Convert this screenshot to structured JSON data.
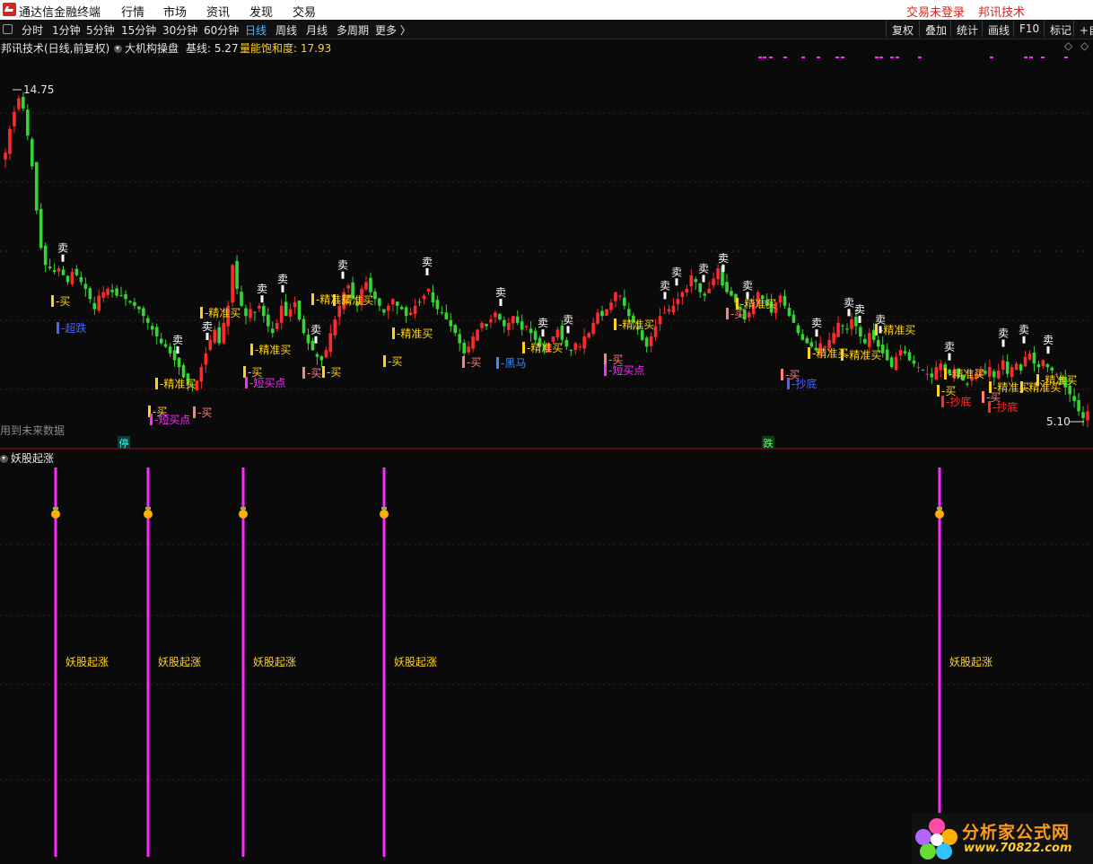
{
  "menubar": {
    "app_title": "通达信金融终端",
    "items": [
      "行情",
      "市场",
      "资讯",
      "发现",
      "交易"
    ],
    "right_items": [
      "交易未登录",
      "邦讯技术"
    ]
  },
  "toolbar": {
    "periods": [
      "分时",
      "1分钟",
      "5分钟",
      "15分钟",
      "30分钟",
      "60分钟",
      "日线",
      "周线",
      "月线",
      "多周期",
      "更多 〉"
    ],
    "active_period": "日线",
    "right_buttons": [
      "复权",
      "叠加",
      "统计",
      "画线",
      "F10",
      "标记",
      "+自"
    ]
  },
  "chart_header": {
    "title": "邦讯技术(日线,前复权)",
    "indicator_name": "大机构操盘",
    "baseline": "基线: 5.27",
    "saturation": "量能饱和度: 17.93"
  },
  "main_chart": {
    "high_label": "14.75",
    "low_label": "5.10",
    "future_note": "用到未来数据",
    "limit_up_badge": "停",
    "limit_down_badge": "跌",
    "sell_label": "卖",
    "signal_texts": {
      "buy": "买",
      "precise_buy": "精准买",
      "oversold": "超跌",
      "short_buy": "短买点",
      "dark_horse": "黑马",
      "bottom": "抄底"
    }
  },
  "chart_data": {
    "type": "candlestick",
    "price_range": [
      5.1,
      14.75
    ],
    "close_series": [
      12.9,
      13.6,
      14.1,
      14.5,
      14.2,
      13.4,
      12.5,
      11.2,
      10.1,
      9.6,
      9.5,
      9.4,
      9.5,
      9.3,
      9.1,
      9.4,
      9.3,
      9.1,
      8.9,
      8.6,
      8.3,
      8.7,
      8.8,
      8.9,
      8.8,
      8.7,
      8.7,
      8.6,
      8.5,
      8.4,
      8.3,
      8.1,
      7.9,
      7.7,
      7.5,
      7.3,
      7.2,
      7.0,
      6.8,
      6.6,
      6.3,
      6.1,
      6.0,
      6.2,
      6.6,
      7.0,
      7.4,
      7.7,
      7.3,
      7.9,
      8.4,
      9.6,
      8.9,
      8.4,
      8.1,
      8.3,
      8.2,
      8.4,
      8.1,
      7.8,
      7.6,
      7.9,
      8.4,
      8.1,
      8.3,
      8.5,
      8.0,
      7.6,
      7.3,
      7.1,
      6.9,
      6.8,
      7.1,
      7.6,
      8.0,
      8.4,
      8.8,
      9.0,
      8.6,
      8.4,
      8.9,
      9.1,
      8.8,
      8.6,
      8.4,
      8.2,
      8.4,
      8.6,
      8.4,
      8.3,
      8.1,
      8.2,
      8.4,
      8.5,
      8.7,
      8.9,
      8.5,
      8.3,
      8.2,
      8.0,
      7.8,
      7.6,
      7.3,
      7.0,
      7.2,
      7.5,
      7.7,
      7.9,
      7.8,
      8.0,
      8.2,
      8.0,
      7.8,
      7.9,
      8.1,
      7.9,
      7.7,
      7.8,
      7.6,
      7.4,
      7.2,
      7.1,
      7.3,
      7.5,
      7.7,
      7.4,
      7.2,
      7.1,
      7.3,
      7.2,
      7.5,
      7.6,
      7.9,
      8.2,
      8.1,
      8.3,
      8.5,
      8.8,
      8.7,
      8.4,
      8.1,
      7.9,
      7.7,
      7.4,
      7.2,
      7.5,
      7.8,
      8.1,
      8.2,
      8.3,
      8.4,
      8.6,
      8.8,
      8.9,
      9.3,
      9.1,
      8.8,
      8.7,
      8.9,
      9.2,
      9.5,
      9.0,
      8.8,
      8.7,
      8.5,
      8.3,
      8.0,
      8.2,
      8.5,
      8.8,
      8.6,
      8.4,
      8.2,
      8.5,
      8.7,
      8.4,
      8.1,
      7.9,
      7.6,
      7.4,
      7.3,
      7.2,
      7.1,
      7.3,
      7.2,
      7.4,
      7.6,
      7.9,
      7.8,
      7.7,
      8.0,
      7.8,
      7.5,
      7.3,
      7.6,
      7.4,
      7.2,
      7.0,
      6.8,
      6.6,
      6.9,
      7.1,
      7.0,
      6.8,
      6.7,
      6.6,
      6.5,
      6.4,
      6.3,
      6.6,
      6.7,
      6.5,
      6.4,
      6.5,
      6.3,
      6.2,
      6.1,
      6.3,
      6.4,
      6.5,
      6.4,
      6.6,
      6.3,
      6.5,
      6.8,
      6.4,
      6.6,
      6.7,
      6.5,
      6.9,
      7.0,
      6.7,
      6.6,
      6.8,
      6.6,
      6.5,
      6.4,
      6.2,
      6.0,
      5.8,
      5.6,
      5.3,
      5.1,
      5.3
    ]
  },
  "indicator": {
    "title": "妖股起涨",
    "signal_label": "妖股起涨",
    "signal_count": 5
  },
  "watermark": {
    "title": "分析家公式网",
    "url": "www.70822.com"
  },
  "colors": {
    "up": "#ff2a2a",
    "down": "#33d633",
    "signal_line": "#ff2aff",
    "label_yellow": "#ffd21a",
    "highlight_blue": "#4fb7ff"
  }
}
